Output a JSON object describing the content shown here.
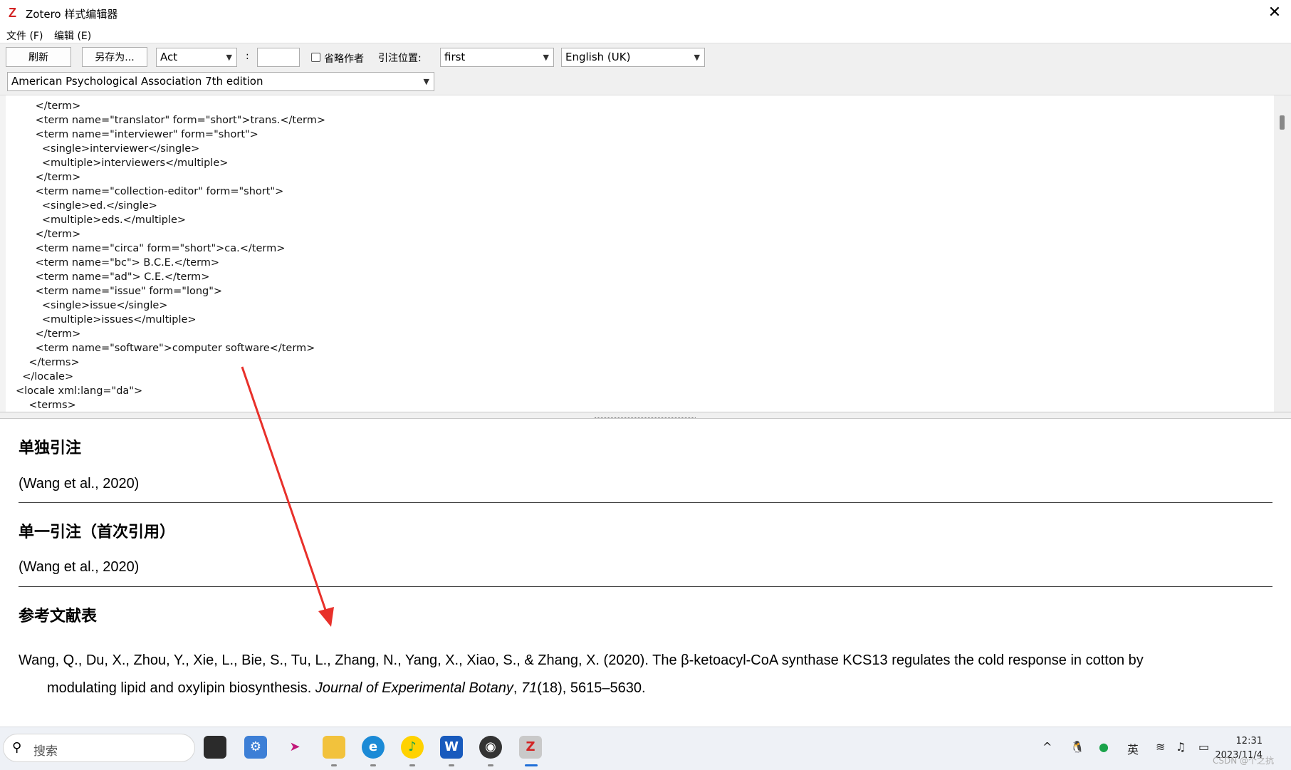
{
  "window": {
    "title": "Zotero 样式编辑器",
    "app_icon": "Z",
    "close_icon": "✕"
  },
  "menu": {
    "file": "文件 (F)",
    "edit": "编辑 (E)"
  },
  "toolbar": {
    "refresh_label": "刷新",
    "save_as_label": "另存为...",
    "locator_type": "Act",
    "colon": ":",
    "locator_value": "",
    "suppress_author_label": "省略作者",
    "position_label": "引注位置:",
    "position_value": "first",
    "locale_value": "English (UK)",
    "style_value": "American Psychological Association 7th edition"
  },
  "editor": {
    "code": "      </term>\n      <term name=\"translator\" form=\"short\">trans.</term>\n      <term name=\"interviewer\" form=\"short\">\n        <single>interviewer</single>\n        <multiple>interviewers</multiple>\n      </term>\n      <term name=\"collection-editor\" form=\"short\">\n        <single>ed.</single>\n        <multiple>eds.</multiple>\n      </term>\n      <term name=\"circa\" form=\"short\">ca.</term>\n      <term name=\"bc\"> B.C.E.</term>\n      <term name=\"ad\"> C.E.</term>\n      <term name=\"issue\" form=\"long\">\n        <single>issue</single>\n        <multiple>issues</multiple>\n      </term>\n      <term name=\"software\">computer software</term>\n    </terms>\n  </locale>\n<locale xml:lang=\"da\">\n    <terms>"
  },
  "preview": {
    "single_citation_heading": "单独引注",
    "single_citation": "(Wang et al., 2020)",
    "first_citation_heading": "单一引注（首次引用）",
    "first_citation": "(Wang et al., 2020)",
    "bibliography_heading": "参考文献表",
    "bibliography": {
      "part1": "Wang, Q., Du, X., Zhou, Y., Xie, L., Bie, S., Tu, L., Zhang, N., Yang, X., Xiao, S., & Zhang, X. (2020). The β-ketoacyl-CoA synthase KCS13 regulates the cold response in cotton by",
      "part2": "modulating lipid and oxylipin biosynthesis. ",
      "journal": "Journal of Experimental Botany",
      "sep": ", ",
      "volume": "71",
      "rest": "(18), 5615–5630."
    }
  },
  "annotation": {
    "arrow_color": "#e8302a"
  },
  "taskbar": {
    "search_placeholder": "搜索",
    "ime_label": "英",
    "time": "12:31",
    "date": "2023/11/4",
    "watermark": "CSDN @个之抗",
    "apps": [
      "taskview-icon",
      "settings-icon",
      "feishu-icon",
      "file-explorer-icon",
      "edge-icon",
      "qqmusic-icon",
      "word-icon",
      "chrome-icon",
      "zotero-icon"
    ]
  }
}
